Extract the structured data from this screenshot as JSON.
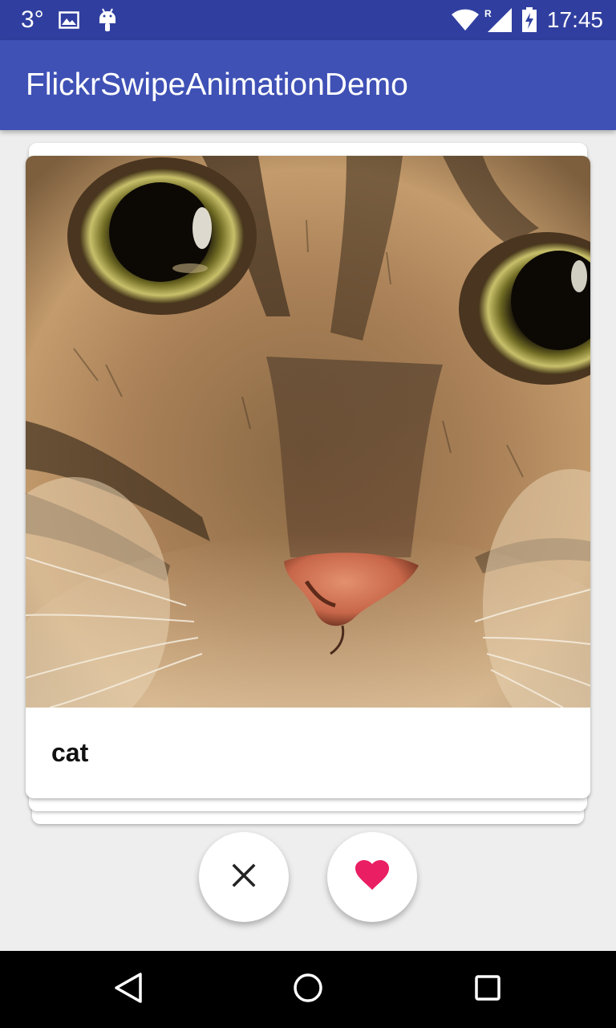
{
  "status_bar": {
    "temperature": "3°",
    "time": "17:45",
    "network_roaming": "R",
    "icons": [
      "image-icon",
      "android-icon",
      "wifi-icon",
      "signal-icon",
      "battery-charging-icon"
    ]
  },
  "app_bar": {
    "title": "FlickrSwipeAnimationDemo",
    "color": "#3f51b5",
    "status_color": "#303f9f"
  },
  "card": {
    "caption": "cat",
    "image": "cat-face-photo"
  },
  "actions": {
    "dislike_icon": "close-icon",
    "like_icon": "heart-icon",
    "like_color": "#e91e63"
  },
  "nav_bar": {
    "icons": [
      "back-icon",
      "home-icon",
      "recents-icon"
    ]
  }
}
